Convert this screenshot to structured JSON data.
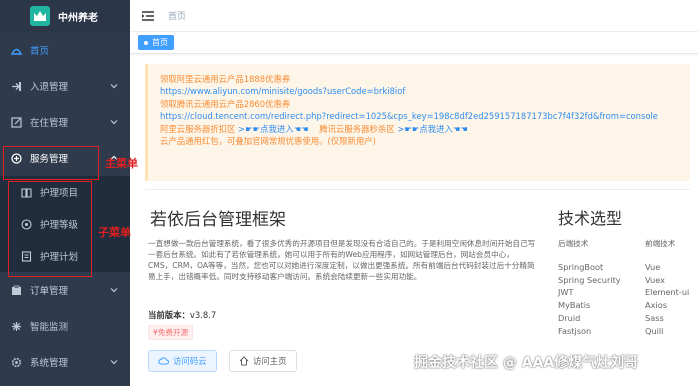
{
  "app": {
    "title": "中州养老"
  },
  "sidebar": {
    "items": [
      {
        "label": "首页",
        "icon": "home-icon",
        "active": true
      },
      {
        "label": "入退管理",
        "icon": "checkin-icon"
      },
      {
        "label": "在住管理",
        "icon": "edit-icon"
      },
      {
        "label": "服务管理",
        "icon": "service-icon",
        "expanded": true
      },
      {
        "label": "订单管理",
        "icon": "order-icon"
      },
      {
        "label": "智能监测",
        "icon": "monitor-icon"
      },
      {
        "label": "系统管理",
        "icon": "settings-icon"
      }
    ],
    "submenu": [
      {
        "label": "护理项目",
        "icon": "book-icon"
      },
      {
        "label": "护理等级",
        "icon": "level-icon"
      },
      {
        "label": "护理计划",
        "icon": "plan-icon"
      }
    ]
  },
  "annotations": {
    "main_menu": "主菜单",
    "sub_menu": "子菜单"
  },
  "header": {
    "breadcrumb": "首页"
  },
  "tags": {
    "active": "首页"
  },
  "notice": {
    "line1": "领取阿里云通用云产品1888优惠券",
    "line2": "https://www.aliyun.com/minisite/goods?userCode=brki8iof",
    "line3": "领取腾讯云通用云产品2860优惠券",
    "line4": "https://cloud.tencent.com/redirect.php?redirect=1025&cps_key=198c8df2ed259157187173bc7f4f32fd&from=console",
    "aliyun_server": "阿里云服务器折扣区",
    "aliyun_link": ">☛☛点我进入☚☚",
    "tencent_server": "腾讯云服务器秒杀区",
    "tencent_link": ">☛☛点我进入☚☚",
    "line6": "云产品通用红包，可叠加官网常规优惠使用。(仅限新用户)"
  },
  "main": {
    "title": "若依后台管理框架",
    "description": "一直想做一款后台管理系统，看了很多优秀的开源项目但是发现没有合适自己的。于是利用空闲休息时间开始自己写一套后台系统。如此有了若依管理系统，她可以用于所有的Web应用程序，如网站管理后台，网站会员中心，CMS，CRM，OA等等，当然，您也可以对她进行深度定制，以做出更强系统。所有前端后台代码封装过后十分精简易上手，出错概率低。同时支持移动客户端访问。系统会陆续更新一些实用功能。",
    "version_label": "当前版本：",
    "version_value": "v3.8.7",
    "free_tag": "¥免费开源",
    "btn_cloud": "访问码云",
    "btn_home": "访问主页"
  },
  "tech": {
    "title": "技术选型",
    "backend_head": "后端技术",
    "frontend_head": "前端技术",
    "backend": [
      "SpringBoot",
      "Spring Security",
      "JWT",
      "MyBatis",
      "Druid",
      "Fastjson"
    ],
    "frontend": [
      "Vue",
      "Vuex",
      "Element-ui",
      "Axios",
      "Sass",
      "Quill"
    ]
  },
  "watermark": "掘金技术社区 @ AAA修煤气灶刘哥"
}
